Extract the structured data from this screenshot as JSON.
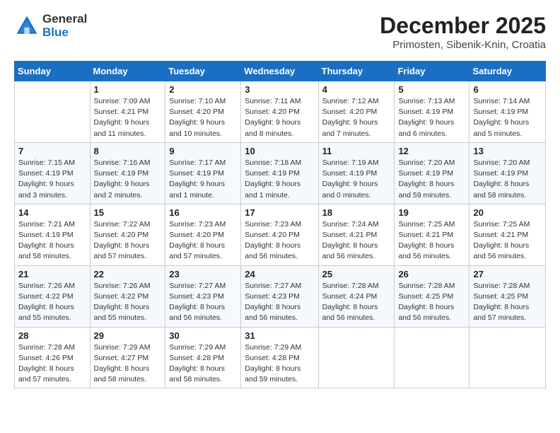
{
  "header": {
    "logo_general": "General",
    "logo_blue": "Blue",
    "month_year": "December 2025",
    "location": "Primosten, Sibenik-Knin, Croatia"
  },
  "days_of_week": [
    "Sunday",
    "Monday",
    "Tuesday",
    "Wednesday",
    "Thursday",
    "Friday",
    "Saturday"
  ],
  "weeks": [
    [
      {
        "day": "",
        "info": ""
      },
      {
        "day": "1",
        "info": "Sunrise: 7:09 AM\nSunset: 4:21 PM\nDaylight: 9 hours\nand 11 minutes."
      },
      {
        "day": "2",
        "info": "Sunrise: 7:10 AM\nSunset: 4:20 PM\nDaylight: 9 hours\nand 10 minutes."
      },
      {
        "day": "3",
        "info": "Sunrise: 7:11 AM\nSunset: 4:20 PM\nDaylight: 9 hours\nand 8 minutes."
      },
      {
        "day": "4",
        "info": "Sunrise: 7:12 AM\nSunset: 4:20 PM\nDaylight: 9 hours\nand 7 minutes."
      },
      {
        "day": "5",
        "info": "Sunrise: 7:13 AM\nSunset: 4:19 PM\nDaylight: 9 hours\nand 6 minutes."
      },
      {
        "day": "6",
        "info": "Sunrise: 7:14 AM\nSunset: 4:19 PM\nDaylight: 9 hours\nand 5 minutes."
      }
    ],
    [
      {
        "day": "7",
        "info": "Sunrise: 7:15 AM\nSunset: 4:19 PM\nDaylight: 9 hours\nand 3 minutes."
      },
      {
        "day": "8",
        "info": "Sunrise: 7:16 AM\nSunset: 4:19 PM\nDaylight: 9 hours\nand 2 minutes."
      },
      {
        "day": "9",
        "info": "Sunrise: 7:17 AM\nSunset: 4:19 PM\nDaylight: 9 hours\nand 1 minute."
      },
      {
        "day": "10",
        "info": "Sunrise: 7:18 AM\nSunset: 4:19 PM\nDaylight: 9 hours\nand 1 minute."
      },
      {
        "day": "11",
        "info": "Sunrise: 7:19 AM\nSunset: 4:19 PM\nDaylight: 9 hours\nand 0 minutes."
      },
      {
        "day": "12",
        "info": "Sunrise: 7:20 AM\nSunset: 4:19 PM\nDaylight: 8 hours\nand 59 minutes."
      },
      {
        "day": "13",
        "info": "Sunrise: 7:20 AM\nSunset: 4:19 PM\nDaylight: 8 hours\nand 58 minutes."
      }
    ],
    [
      {
        "day": "14",
        "info": "Sunrise: 7:21 AM\nSunset: 4:19 PM\nDaylight: 8 hours\nand 58 minutes."
      },
      {
        "day": "15",
        "info": "Sunrise: 7:22 AM\nSunset: 4:20 PM\nDaylight: 8 hours\nand 57 minutes."
      },
      {
        "day": "16",
        "info": "Sunrise: 7:23 AM\nSunset: 4:20 PM\nDaylight: 8 hours\nand 57 minutes."
      },
      {
        "day": "17",
        "info": "Sunrise: 7:23 AM\nSunset: 4:20 PM\nDaylight: 8 hours\nand 56 minutes."
      },
      {
        "day": "18",
        "info": "Sunrise: 7:24 AM\nSunset: 4:21 PM\nDaylight: 8 hours\nand 56 minutes."
      },
      {
        "day": "19",
        "info": "Sunrise: 7:25 AM\nSunset: 4:21 PM\nDaylight: 8 hours\nand 56 minutes."
      },
      {
        "day": "20",
        "info": "Sunrise: 7:25 AM\nSunset: 4:21 PM\nDaylight: 8 hours\nand 56 minutes."
      }
    ],
    [
      {
        "day": "21",
        "info": "Sunrise: 7:26 AM\nSunset: 4:22 PM\nDaylight: 8 hours\nand 55 minutes."
      },
      {
        "day": "22",
        "info": "Sunrise: 7:26 AM\nSunset: 4:22 PM\nDaylight: 8 hours\nand 55 minutes."
      },
      {
        "day": "23",
        "info": "Sunrise: 7:27 AM\nSunset: 4:23 PM\nDaylight: 8 hours\nand 56 minutes."
      },
      {
        "day": "24",
        "info": "Sunrise: 7:27 AM\nSunset: 4:23 PM\nDaylight: 8 hours\nand 56 minutes."
      },
      {
        "day": "25",
        "info": "Sunrise: 7:28 AM\nSunset: 4:24 PM\nDaylight: 8 hours\nand 56 minutes."
      },
      {
        "day": "26",
        "info": "Sunrise: 7:28 AM\nSunset: 4:25 PM\nDaylight: 8 hours\nand 56 minutes."
      },
      {
        "day": "27",
        "info": "Sunrise: 7:28 AM\nSunset: 4:25 PM\nDaylight: 8 hours\nand 57 minutes."
      }
    ],
    [
      {
        "day": "28",
        "info": "Sunrise: 7:28 AM\nSunset: 4:26 PM\nDaylight: 8 hours\nand 57 minutes."
      },
      {
        "day": "29",
        "info": "Sunrise: 7:29 AM\nSunset: 4:27 PM\nDaylight: 8 hours\nand 58 minutes."
      },
      {
        "day": "30",
        "info": "Sunrise: 7:29 AM\nSunset: 4:28 PM\nDaylight: 8 hours\nand 58 minutes."
      },
      {
        "day": "31",
        "info": "Sunrise: 7:29 AM\nSunset: 4:28 PM\nDaylight: 8 hours\nand 59 minutes."
      },
      {
        "day": "",
        "info": ""
      },
      {
        "day": "",
        "info": ""
      },
      {
        "day": "",
        "info": ""
      }
    ]
  ]
}
